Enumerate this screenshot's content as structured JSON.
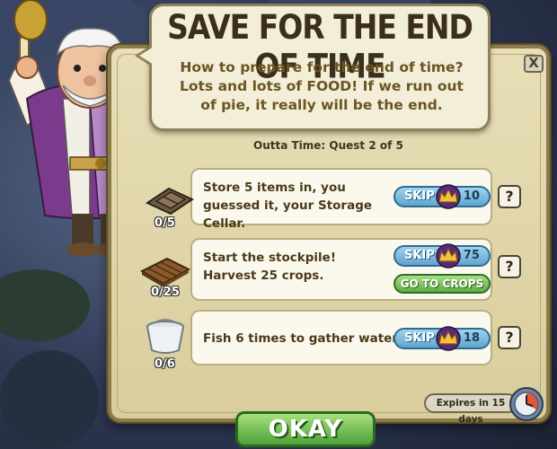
{
  "dialog": {
    "title": "SAVE FOR THE END OF TIME",
    "message": "How to prepare for the end of time? Lots and lots of FOOD! If we run out of pie, it really will be the end.",
    "close_label": "X",
    "quest_progress": "Outta Time: Quest 2 of 5"
  },
  "tasks": [
    {
      "description": "Store 5 items in, you guessed it, your Storage Cellar.",
      "count": "0/5",
      "skip_label": "SKIP",
      "skip_cost": "10",
      "help_label": "?",
      "icon": "storage-cellar-icon"
    },
    {
      "description": "Start the stockpile! Harvest 25 crops.",
      "count": "0/25",
      "skip_label": "SKIP",
      "skip_cost": "75",
      "goto_label": "GO TO CROPS",
      "help_label": "?",
      "icon": "crop-plot-icon"
    },
    {
      "description": "Fish 6 times to gather water.",
      "count": "0/6",
      "skip_label": "SKIP",
      "skip_cost": "18",
      "help_label": "?",
      "icon": "water-bucket-icon"
    }
  ],
  "footer": {
    "expires_label": "Expires in 15 days",
    "okay_label": "OKAY"
  },
  "colors": {
    "parchment": "#d9cd9c",
    "skip_blue": "#5fa5cf",
    "go_green": "#5eae44",
    "okay_green": "#4ea13a"
  }
}
